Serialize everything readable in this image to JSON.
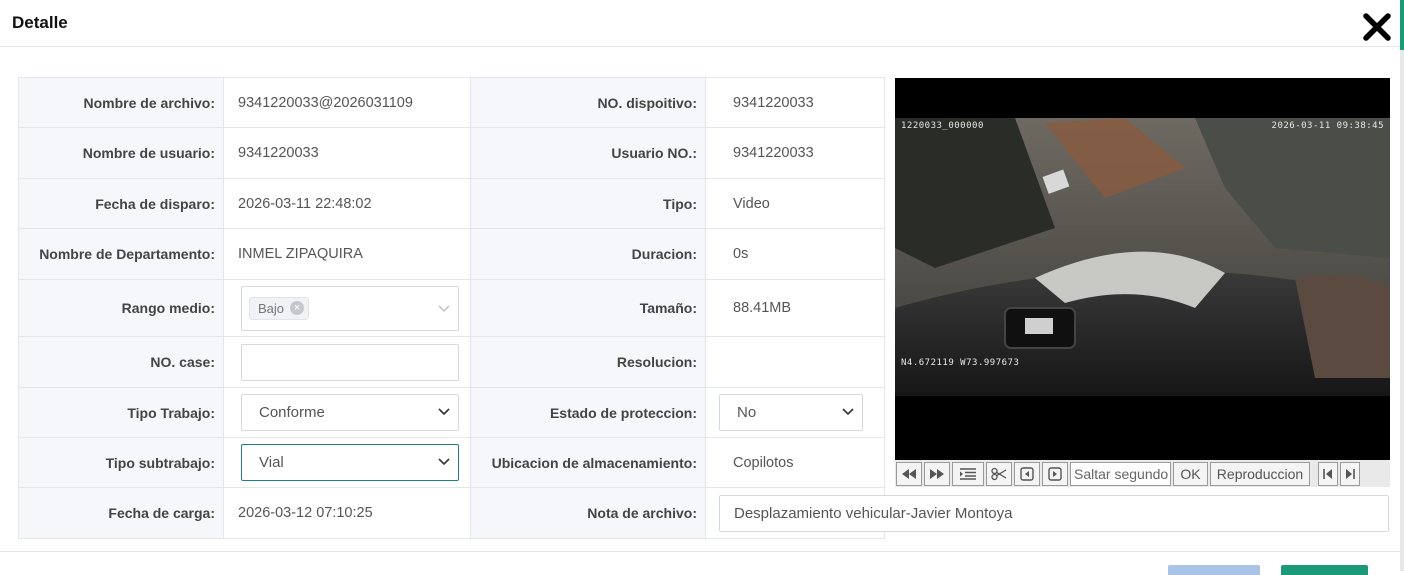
{
  "dialog": {
    "title": "Detalle"
  },
  "fields": {
    "nombre_archivo": {
      "label": "Nombre de archivo:",
      "value": "9341220033@2026031109"
    },
    "no_dispositivo": {
      "label": "NO. dispoitivo:",
      "value": "9341220033"
    },
    "nombre_usuario": {
      "label": "Nombre de usuario:",
      "value": "9341220033"
    },
    "usuario_no": {
      "label": "Usuario NO.:",
      "value": "9341220033"
    },
    "fecha_disparo": {
      "label": "Fecha de disparo:",
      "value": "2026-03-11 22:48:02"
    },
    "tipo": {
      "label": "Tipo:",
      "value": "Video"
    },
    "departamento": {
      "label": "Nombre de Departamento:",
      "value": "INMEL ZIPAQUIRA"
    },
    "duracion": {
      "label": "Duracion:",
      "value": "0s"
    },
    "rango_medio": {
      "label": "Rango medio:",
      "tag": "Bajo"
    },
    "tamano": {
      "label": "Tamaño:",
      "value": "88.41MB"
    },
    "no_case": {
      "label": "NO. case:",
      "value": ""
    },
    "resolucion": {
      "label": "Resolucion:",
      "value": ""
    },
    "tipo_trabajo": {
      "label": "Tipo Trabajo:",
      "value": "Conforme"
    },
    "estado_proteccion": {
      "label": "Estado de proteccion:",
      "value": "No"
    },
    "tipo_subtrabajo": {
      "label": "Tipo subtrabajo:",
      "value": "Vial"
    },
    "ubicacion": {
      "label": "Ubicacion de almacenamiento:",
      "value": "Copilotos"
    },
    "fecha_carga": {
      "label": "Fecha de carga:",
      "value": "2026-03-12 07:10:25"
    },
    "nota_archivo": {
      "label": "Nota de archivo:",
      "value": "Desplazamiento vehicular-Javier Montoya"
    }
  },
  "video": {
    "osd_top_left": "1220033_000000",
    "osd_top_right": "2026-03-11 09:38:45",
    "osd_gps": "N4.672119  W73.997673"
  },
  "player_controls": {
    "seek_placeholder": "Saltar segundo",
    "ok_label": "OK",
    "playback_label": "Reproduccion"
  },
  "colors": {
    "accent": "#1a9a78",
    "label_bg": "#f5f7fa",
    "focus_border": "#1e7d8c"
  }
}
